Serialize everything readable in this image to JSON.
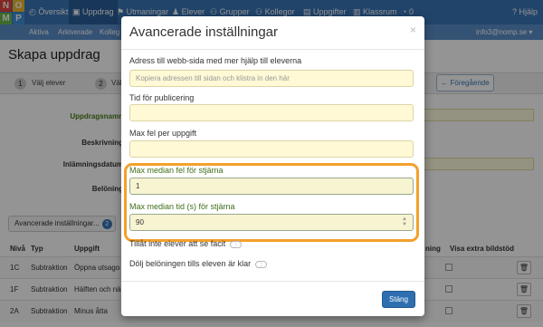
{
  "nav": {
    "logo_letters": [
      "N",
      "O",
      "M",
      "P"
    ],
    "overview": "Översikt",
    "assignments": "Uppdrag",
    "challenges": "Utmaningar",
    "students": "Elever",
    "groups": "Grupper",
    "colleagues": "Kollegor",
    "tasks": "Uppgifter",
    "classroom": "Klassrum",
    "notifications": "0",
    "help": "Hjälp"
  },
  "subnav": {
    "active": "Aktiva",
    "archived": "Arkiverade",
    "colleagues": "Kolleg",
    "user_email": "info3@nomp.se"
  },
  "page": {
    "title": "Skapa uppdrag",
    "step1_num": "1",
    "step1_label": "Välj elever",
    "step2_num": "2",
    "step2_label": "Väl",
    "prev_button": "Föregående",
    "form_labels": [
      "Uppdragsnamn",
      "Beskrivning",
      "Inlämningsdatum",
      "Belöning"
    ],
    "advanced_button": "Avancerade inställningar...",
    "advanced_count": "2",
    "table_headers": {
      "level": "Nivå",
      "type": "Typ",
      "task": "Uppgift",
      "reward": "ning",
      "extra_support": "Visa extra bildstöd"
    },
    "rows": [
      {
        "level": "1C",
        "type": "Subtraktion",
        "task": "Öppna utsago"
      },
      {
        "level": "1F",
        "type": "Subtraktion",
        "task": "Hälften och nä"
      },
      {
        "level": "2A",
        "type": "Subtraktion",
        "task": "Minus åtta"
      }
    ]
  },
  "modal": {
    "title": "Avancerade inställningar",
    "close_x": "×",
    "web_address_label": "Adress till webb-sida med mer hjälp till eleverna",
    "web_address_placeholder": "Kopiera adressen till sidan och klistra in den här",
    "publish_time_label": "Tid för publicering",
    "publish_time_value": "",
    "max_errors_label": "Max fel per uppgift",
    "max_errors_value": "",
    "max_median_errors_label": "Max median fel för stjärna",
    "max_median_errors_value": "1",
    "max_median_time_label": "Max median tid (s) för stjärna",
    "max_median_time_value": "90",
    "disallow_facit_label": "Tillåt inte elever att se facit",
    "hide_reward_label": "Dölj belöningen tills eleven är klar",
    "close_button": "Stäng"
  },
  "colors": {
    "nav_blue": "#3a76b8",
    "highlight_orange": "#f3a12b",
    "input_yellow": "#fff9d6",
    "label_green": "#3f6f19"
  }
}
